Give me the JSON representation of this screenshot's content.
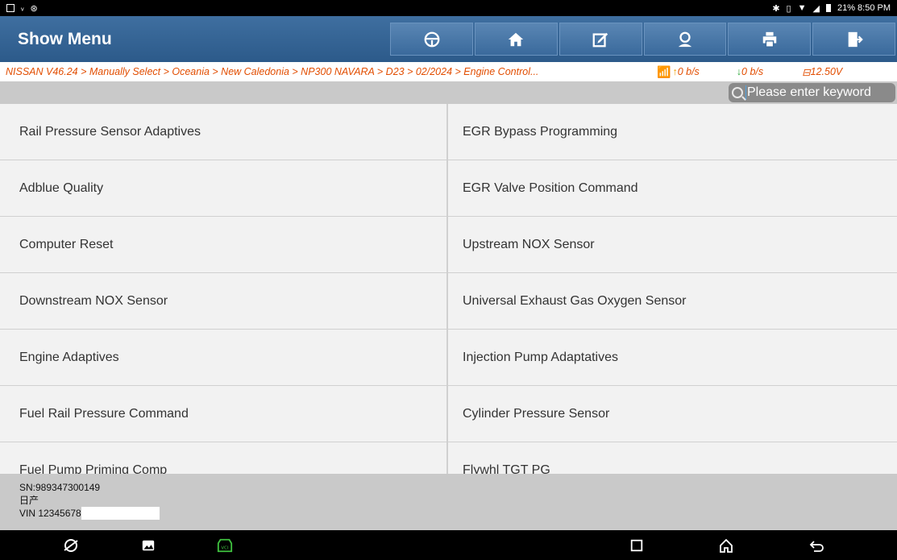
{
  "status_bar": {
    "right_text": "21% 8:50 PM"
  },
  "header": {
    "title": "Show Menu",
    "toolbar": [
      "steering-wheel-icon",
      "home-icon",
      "edit-icon",
      "user-icon",
      "printer-icon",
      "exit-icon"
    ]
  },
  "breadcrumb": {
    "path": "NISSAN V46.24 > Manually Select > Oceania > New Caledonia > NP300 NAVARA > D23 > 02/2024 > Engine Control...",
    "upload_rate": "0 b/s",
    "download_rate": "0 b/s",
    "voltage": "12.50V"
  },
  "search": {
    "placeholder": "Please enter keyword"
  },
  "menu": {
    "rows": [
      {
        "left": "Rail Pressure Sensor Adaptives",
        "right": "EGR Bypass Programming"
      },
      {
        "left": "Adblue Quality",
        "right": "EGR Valve Position Command"
      },
      {
        "left": "Computer Reset",
        "right": "Upstream NOX Sensor"
      },
      {
        "left": "Downstream NOX Sensor",
        "right": "Universal Exhaust Gas Oxygen Sensor"
      },
      {
        "left": "Engine Adaptives",
        "right": "Injection Pump Adaptatives"
      },
      {
        "left": "Fuel Rail Pressure Command",
        "right": "Cylinder Pressure Sensor"
      },
      {
        "left": "Fuel Pump Priming Comp",
        "right": "Flywhl TGT PG"
      }
    ]
  },
  "footer": {
    "sn": "SN:989347300149",
    "brand": "日产",
    "vin": "VIN 12345678"
  },
  "colors": {
    "header_blue": "#2c5a8a",
    "breadcrumb_orange": "#e24d00",
    "up_arrow": "#f0a000",
    "down_arrow": "#2aa83a"
  }
}
